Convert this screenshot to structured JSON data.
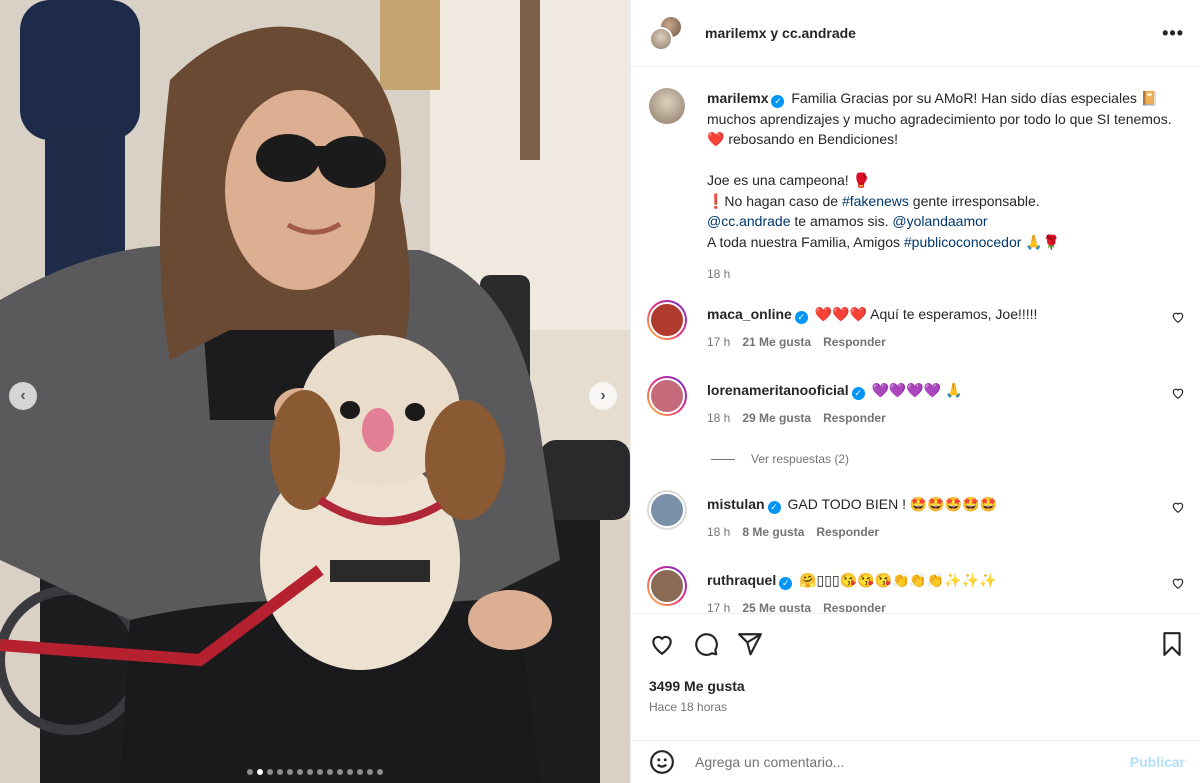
{
  "post": {
    "header_title": "marilemx y cc.andrade",
    "carousel_dots": 14,
    "active_dot": 1
  },
  "caption": {
    "username": "marilemx",
    "line1": " Familia Gracias por su AMoR! Han sido días especiales 📔 muchos aprendizajes y mucho agradecimiento por todo lo que SI tenemos. ❤️ rebosando en Bendiciones!",
    "line2": "Joe es una campeona! 🥊",
    "line3_prefix": "❗No hagan caso de ",
    "line3_tag": "#fakenews",
    "line3_suffix": " gente irresponsable.",
    "line4_mention1": "@cc.andrade",
    "line4_mid": " te amamos sis. ",
    "line4_mention2": "@yolandaamor",
    "line5_prefix": "A toda nuestra Familia, Amigos ",
    "line5_tag": "#publicoconocedor",
    "line5_suffix": " 🙏🌹",
    "time": "18 h"
  },
  "comments": [
    {
      "username": "maca_online",
      "text": "❤️❤️❤️ Aquí te esperamos, Joe!!!!!",
      "time": "17 h",
      "likes": "21 Me gusta",
      "reply": "Responder",
      "color": "#b03a2e"
    },
    {
      "username": "lorenameritanooficial",
      "text": "💜💜💜💜 🙏",
      "time": "18 h",
      "likes": "29 Me gusta",
      "reply": "Responder",
      "color": "#c46a7a"
    },
    {
      "username": "mistulan",
      "text": "GAD TODO BIEN ! 🤩🤩🤩🤩🤩",
      "time": "18 h",
      "likes": "8 Me gusta",
      "reply": "Responder",
      "color": "#7a8fa8"
    },
    {
      "username": "ruthraquel",
      "text": "🤗▯▯▯😘😘😘👏👏👏✨✨✨",
      "time": "17 h",
      "likes": "25 Me gusta",
      "reply": "Responder",
      "color": "#8a6a55"
    }
  ],
  "view_replies": "Ver respuestas (2)",
  "likes": "3499 Me gusta",
  "posted_ago": "Hace 18 horas",
  "comment_input": {
    "placeholder": "Agrega un comentario..."
  },
  "publish_label": "Publicar",
  "icons": [
    "more-icon",
    "heart-icon",
    "comment-icon",
    "share-icon",
    "save-icon",
    "emoji-icon",
    "chevron-left-icon",
    "chevron-right-icon"
  ]
}
